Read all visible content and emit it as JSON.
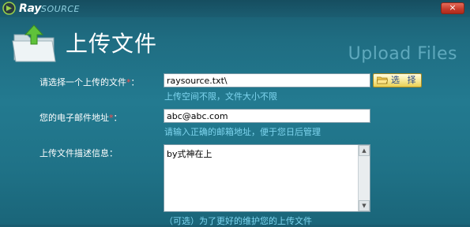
{
  "window": {
    "logo_brand": "Ray",
    "logo_sub": "SOURCE",
    "close_label": "×"
  },
  "header": {
    "title": "上传文件",
    "watermark": "Upload Files"
  },
  "form": {
    "file": {
      "label": "请选择一个上传的文件",
      "required_mark": "*",
      "colon": "：",
      "value": "raysource.txt\\",
      "button_label": "选 择",
      "hint": "上传空间不限，文件大小不限"
    },
    "email": {
      "label": "您的电子邮件地址",
      "required_mark": "*",
      "colon": "：",
      "value": "abc@abc.com",
      "hint": "请输入正确的邮箱地址，便于您日后管理"
    },
    "description": {
      "label": "上传文件描述信息：",
      "value": "by式神在上",
      "hint": "（可选）为了更好的维护您的上传文件"
    }
  },
  "icons": {
    "logo": "raysource-logo-icon",
    "header": "upload-folder-icon",
    "choose": "folder-open-icon",
    "scroll_up": "scroll-up-arrow-icon",
    "scroll_down": "scroll-down-arrow-icon"
  },
  "colors": {
    "background": "#237a90",
    "hint": "#7fd6f0",
    "required": "#ff4a4a",
    "close": "#c43a2a",
    "button": "#f7e99a"
  }
}
